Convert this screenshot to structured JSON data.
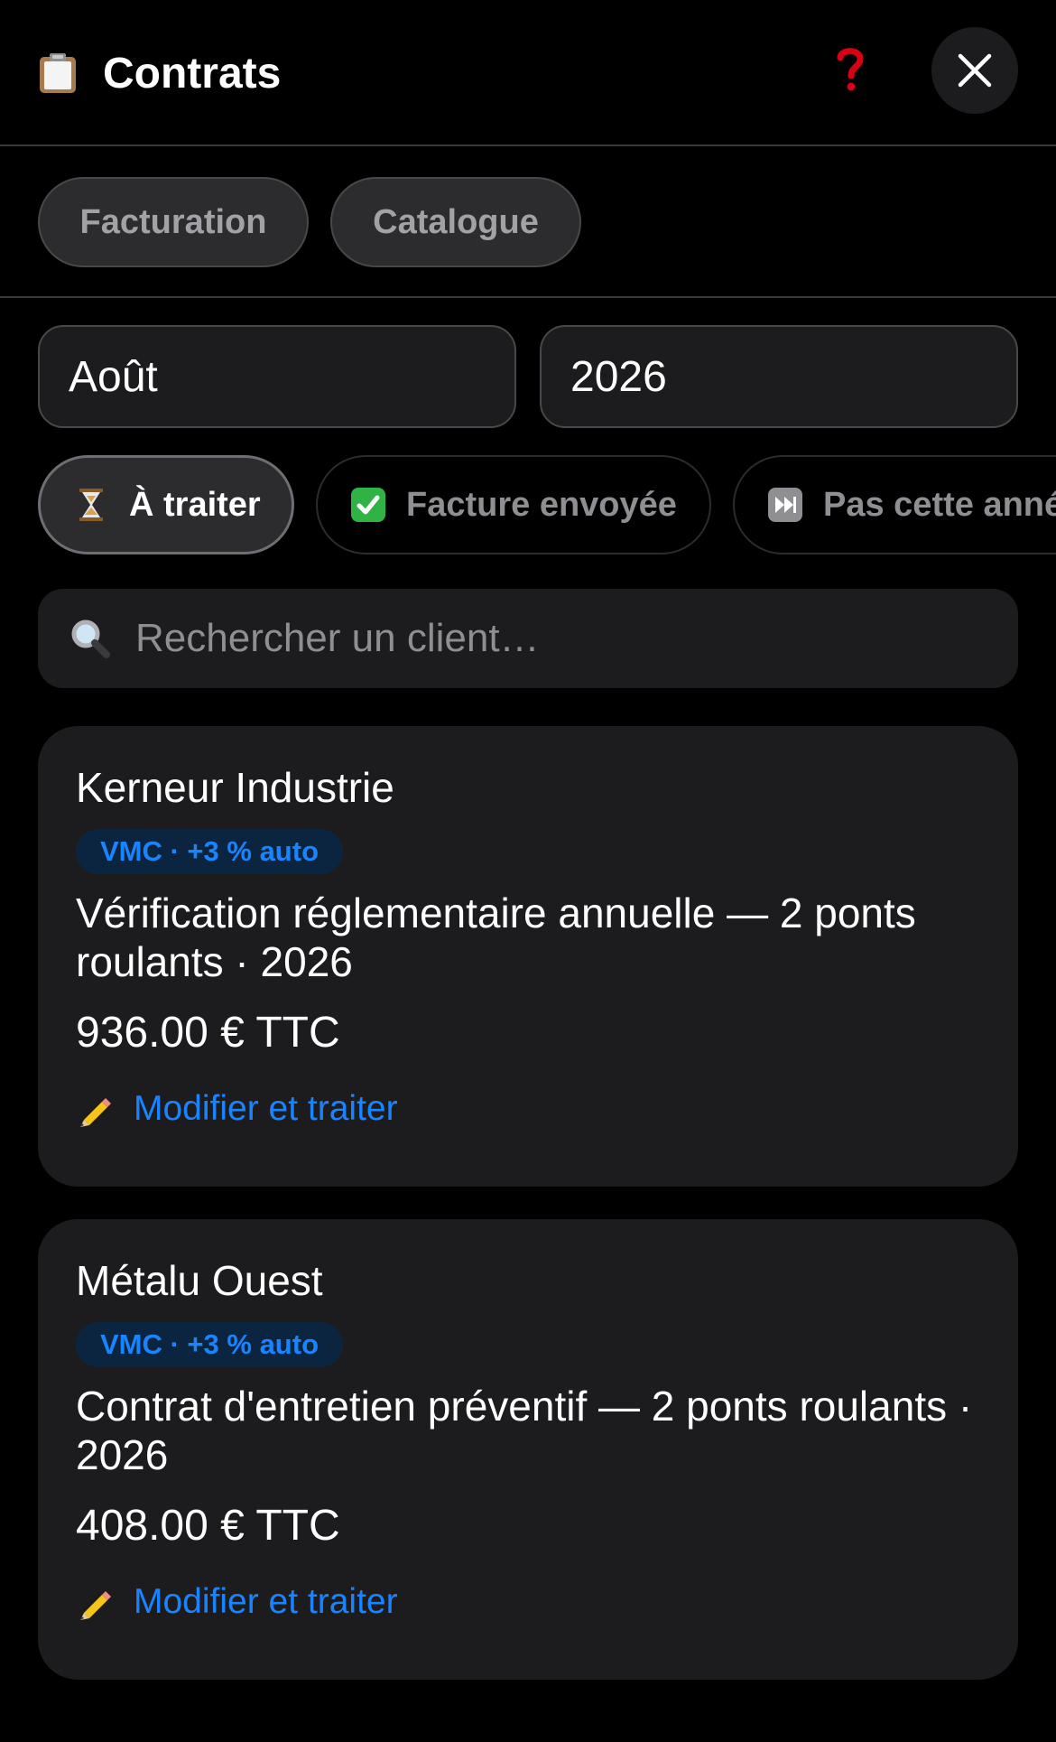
{
  "header": {
    "title": "Contrats",
    "icon": "clipboard-icon",
    "help_icon": "question-mark-icon",
    "close_icon": "close-icon"
  },
  "tabs": [
    {
      "label": "Facturation"
    },
    {
      "label": "Catalogue"
    }
  ],
  "filters": {
    "month": "Août",
    "year": "2026"
  },
  "status_filters": [
    {
      "label": "À traiter",
      "icon": "hourglass-icon",
      "active": true
    },
    {
      "label": "Facture envoyée",
      "icon": "check-mark-icon",
      "active": false
    },
    {
      "label": "Pas cette année",
      "icon": "next-track-icon",
      "active": false
    }
  ],
  "search": {
    "placeholder": "Rechercher un client…",
    "value": ""
  },
  "contracts": [
    {
      "client": "Kerneur Industrie",
      "badge": "VMC · +3 % auto",
      "description": "Vérification réglementaire annuelle — 2 ponts roulants · 2026",
      "amount": "936.00 € TTC",
      "action_label": "Modifier et traiter"
    },
    {
      "client": "Métalu Ouest",
      "badge": "VMC · +3 % auto",
      "description": "Contrat d'entretien préventif — 2 ponts roulants · 2026",
      "amount": "408.00 € TTC",
      "action_label": "Modifier et traiter"
    }
  ],
  "colors": {
    "background": "#000000",
    "surface": "#1c1c1e",
    "accent": "#1a84ff",
    "badge_background": "#0b2540",
    "muted_text": "#8e8e93",
    "help_red": "#d70015",
    "check_green": "#2fb344"
  }
}
